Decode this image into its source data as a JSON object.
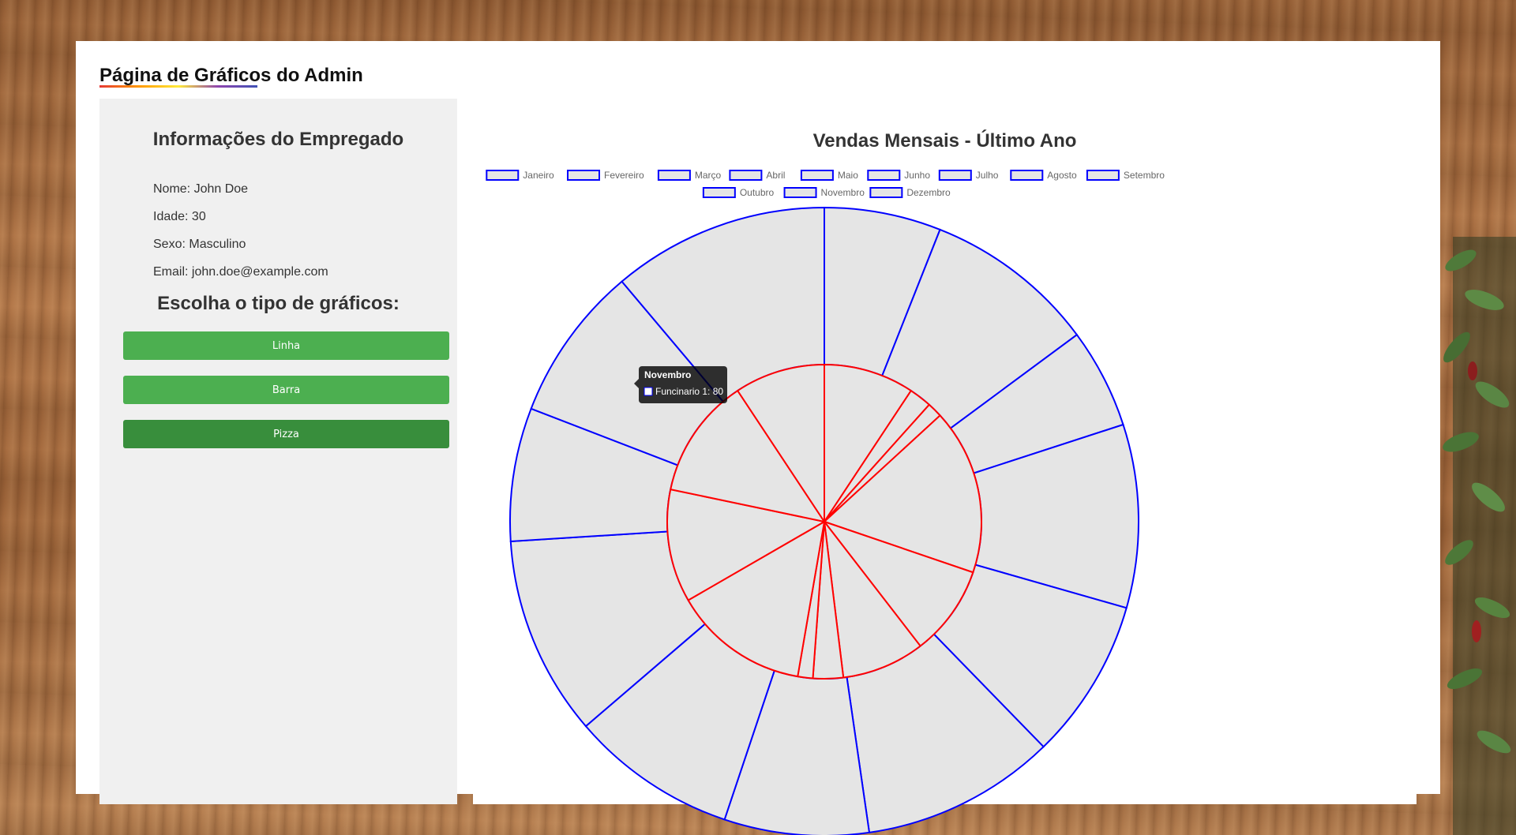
{
  "page_title": "Página de Gráficos do Admin",
  "employee": {
    "heading": "Informações do Empregado",
    "name": "Nome: John Doe",
    "age": "Idade: 30",
    "sex": "Sexo: Masculino",
    "email": "Email: john.doe@example.com"
  },
  "chart_type_heading": "Escolha o tipo de gráficos:",
  "buttons": [
    {
      "label": "Linha",
      "active": false
    },
    {
      "label": "Barra",
      "active": false
    },
    {
      "label": "Pizza",
      "active": true
    }
  ],
  "colors": {
    "outer_border": "#0000ff",
    "inner_border": "#ff0000",
    "slice_fill": "#e5e5e5",
    "button": "#4caf50",
    "button_active": "#388e3c"
  },
  "tooltip": {
    "title": "Novembro",
    "label": "Funcinario 1: 80"
  },
  "chart_data": {
    "type": "pie",
    "title": "Vendas Mensais - Último Ano",
    "legend_position": "top",
    "categories": [
      "Janeiro",
      "Fevereiro",
      "Março",
      "Abril",
      "Maio",
      "Junho",
      "Julho",
      "Agosto",
      "Setembro",
      "Outubro",
      "Novembro",
      "Dezembro"
    ],
    "series": [
      {
        "name": "",
        "values": [
          21,
          31,
          18,
          33,
          29,
          35,
          26,
          30,
          36,
          24,
          28,
          39
        ]
      },
      {
        "name": "Funcinario 1",
        "values": [
          60,
          15,
          10,
          110,
          60,
          55,
          20,
          10,
          90,
          75,
          80,
          60
        ]
      }
    ]
  }
}
